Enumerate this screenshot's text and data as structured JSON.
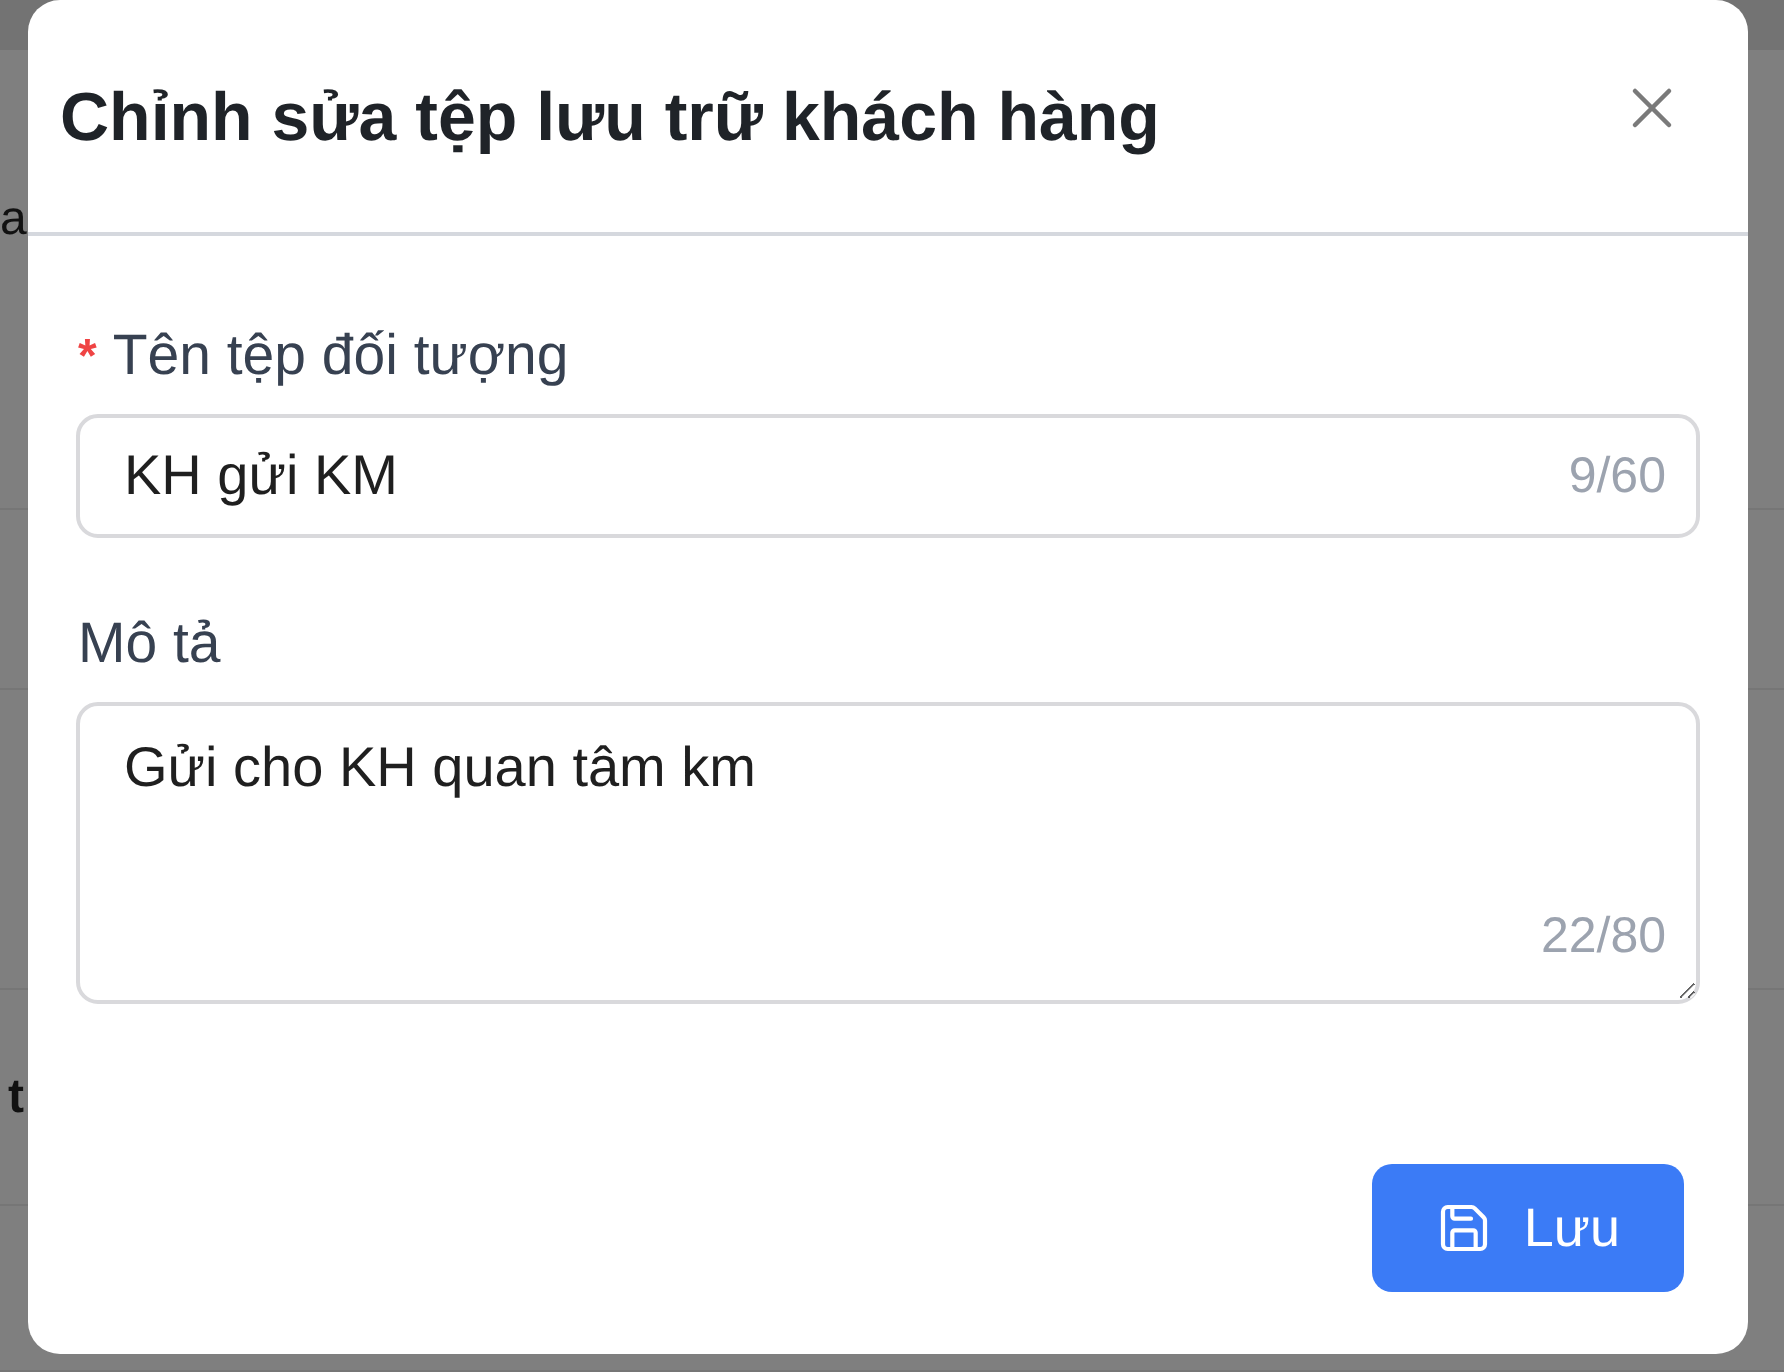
{
  "background": {
    "fragments": [
      "a",
      "t"
    ]
  },
  "dialog": {
    "title": "Chỉnh sửa tệp lưu trữ khách hàng",
    "fields": [
      {
        "kind": "input",
        "required_mark": "*",
        "label": "Tên tệp đối tượng",
        "value": "KH gửi KM",
        "counter": "9/60"
      },
      {
        "kind": "textarea",
        "label": "Mô tả",
        "value": "Gửi cho KH quan tâm km",
        "counter": "22/80"
      }
    ],
    "actions": [
      {
        "kind": "primary",
        "label": "Lưu"
      }
    ]
  }
}
